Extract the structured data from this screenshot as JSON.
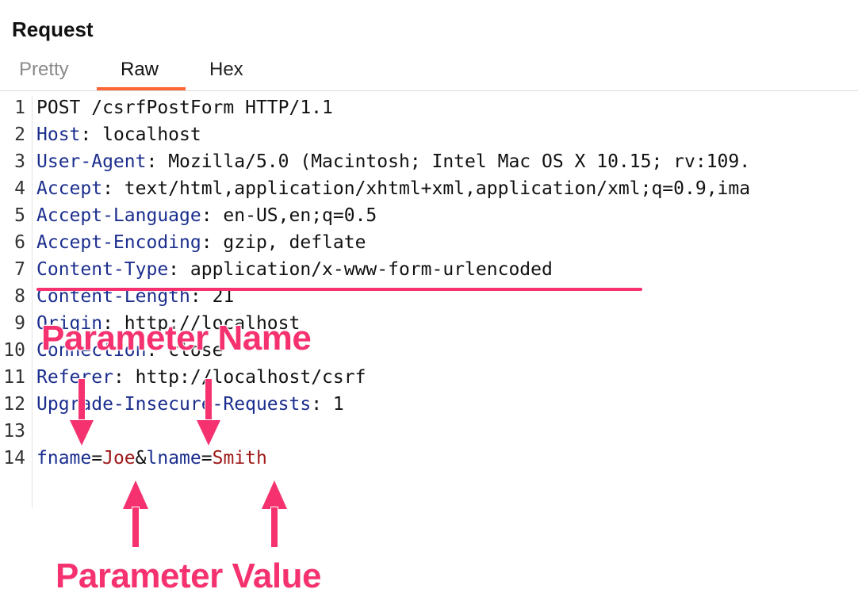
{
  "panel": {
    "title": "Request"
  },
  "tabs": [
    {
      "label": "Pretty"
    },
    {
      "label": "Raw"
    },
    {
      "label": "Hex"
    }
  ],
  "editor": {
    "line_numbers": [
      "1",
      "2",
      "3",
      "4",
      "5",
      "6",
      "7",
      "8",
      "9",
      "10",
      "11",
      "12",
      "13",
      "14"
    ],
    "request_line": "POST /csrfPostForm HTTP/1.1",
    "headers": [
      {
        "name": "Host",
        "sep": ": ",
        "value": "localhost"
      },
      {
        "name": "User-Agent",
        "sep": ": ",
        "value": "Mozilla/5.0 (Macintosh; Intel Mac OS X 10.15; rv:109."
      },
      {
        "name": "Accept",
        "sep": ": ",
        "value": "text/html,application/xhtml+xml,application/xml;q=0.9,ima"
      },
      {
        "name": "Accept-Language",
        "sep": ": ",
        "value": "en-US,en;q=0.5"
      },
      {
        "name": "Accept-Encoding",
        "sep": ": ",
        "value": "gzip, deflate"
      },
      {
        "name": "Content-Type",
        "sep": ": ",
        "value": "application/x-www-form-urlencoded"
      },
      {
        "name": "Content-Length",
        "sep": ": ",
        "value": "21"
      },
      {
        "name": "Origin",
        "sep": ": ",
        "value": "http://localhost"
      },
      {
        "name": "Connection",
        "sep": ": ",
        "value": "close"
      },
      {
        "name": "Referer",
        "sep": ": ",
        "value": "http://localhost/csrf"
      },
      {
        "name": "Upgrade-Insecure-Requests",
        "sep": ": ",
        "value": "1"
      }
    ],
    "body": {
      "param1_name": "fname",
      "eq1": "=",
      "param1_value": "Joe",
      "amp": "&",
      "param2_name": "lname",
      "eq2": "=",
      "param2_value": "Smith"
    }
  },
  "annotations": {
    "name_label": "Parameter Name",
    "value_label": "Parameter Value",
    "color": "#f5326f"
  },
  "colors": {
    "tab_accent": "#ff6633",
    "header_name": "#1b2e8e",
    "param_value": "#a01a1a"
  }
}
